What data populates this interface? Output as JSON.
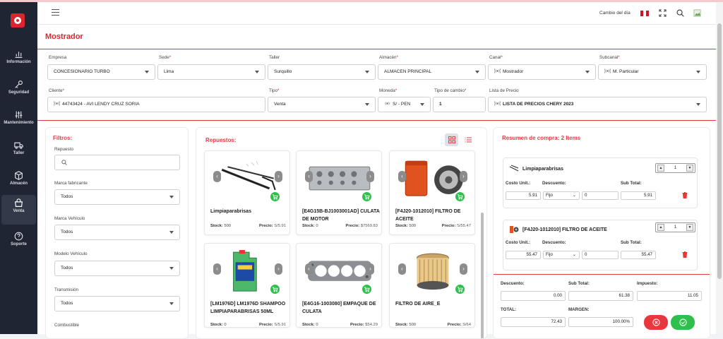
{
  "colors": {
    "accent": "#d9262e",
    "sidebar": "#1f2532",
    "green": "#2fbf4c"
  },
  "sidebar": {
    "items": [
      {
        "label": "Información",
        "icon": "bar-chart-icon"
      },
      {
        "label": "Seguridad",
        "icon": "key-icon"
      },
      {
        "label": "Mantenimiento",
        "icon": "sliders-icon"
      },
      {
        "label": "Taller",
        "icon": "truck-icon"
      },
      {
        "label": "Almacén",
        "icon": "box-icon"
      },
      {
        "label": "Venta",
        "icon": "bag-icon",
        "active": true
      },
      {
        "label": "Soporte",
        "icon": "help-icon"
      }
    ]
  },
  "header": {
    "cambio_label": "Cambio del día"
  },
  "page": {
    "title": "Mostrador"
  },
  "form": {
    "empresa": {
      "label": "Empresa",
      "value": "CONCESIONARIO TURBO"
    },
    "sede": {
      "label": "Sede",
      "value": "Lima"
    },
    "taller": {
      "label": "Taller",
      "value": "Surquillo"
    },
    "almacen": {
      "label": "Almacén",
      "value": "ALMACEN PRINCIPAL"
    },
    "canal": {
      "label": "Canal",
      "value": "Mostrador"
    },
    "subcanal": {
      "label": "Subcanal",
      "value": "M. Particular"
    },
    "cliente": {
      "label": "Cliente",
      "value": "44743424 - AVI LENDY CRUZ SORIA"
    },
    "tipo": {
      "label": "Tipo",
      "value": "Venta"
    },
    "moneda": {
      "label": "Moneda",
      "value": "S/ - PEN"
    },
    "tipo_cambio": {
      "label": "Tipo de cambio",
      "value": "1"
    },
    "lista_precio": {
      "label": "Lista de Precio",
      "value": "LISTA DE PRECIOS CHERY 2023"
    }
  },
  "filters": {
    "title": "Filtros:",
    "repuesto_label": "Repuesto",
    "marca_fabricante": {
      "label": "Marca fabricante",
      "value": "Todos"
    },
    "marca_vehiculo": {
      "label": "Marca Vehículo",
      "value": "Todos"
    },
    "modelo_vehiculo": {
      "label": "Modelo Vehículo",
      "value": "Todos"
    },
    "transmision": {
      "label": "Transmisión",
      "value": "Todos"
    },
    "combustible": {
      "label": "Combustible"
    }
  },
  "repuestos": {
    "title": "Repuestos:",
    "stock_label": "Stock:",
    "price_label": "Precio:",
    "cards": [
      {
        "name": "Limpiaparabrisas",
        "stock": "500",
        "price": "S/5.91",
        "img": "wiper"
      },
      {
        "name": "[E4G15B-BJ1003001AD] CULATA DE MOTOR",
        "stock": "0",
        "price": "$7569.83",
        "img": "head"
      },
      {
        "name": "[F4J20-1012010] FILTRO DE ACEITE",
        "stock": "500",
        "price": "S/55.47",
        "img": "oil"
      },
      {
        "name": "[LM1976D] LM1976D SHAMPOO LIMPIAPARABRISAS 50ML",
        "stock": "0",
        "price": "S/5.91",
        "img": "jug"
      },
      {
        "name": "[E4G16-1003080] EMPAQUE DE CULATA",
        "stock": "0",
        "price": "$54.29",
        "img": "gasket"
      },
      {
        "name": "FILTRO DE AIRE_E",
        "stock": "500",
        "price": "S/64",
        "img": "air"
      }
    ]
  },
  "resumen": {
    "title": "Resumen de compra: 2 Items",
    "costo_label": "Costo Unit.:",
    "descuento_label": "Descuento:",
    "subtotal_label": "Sub Total:",
    "items": [
      {
        "name": "Limpiaparabrisas",
        "qty": "1",
        "costo": "5.91",
        "tipo": "Fijo",
        "descuento": "0",
        "subtotal": "5.91"
      },
      {
        "name": "[F4J20-1012010] FILTRO DE ACEITE",
        "qty": "1",
        "costo": "55.47",
        "tipo": "Fijo",
        "descuento": "0",
        "subtotal": "55.47"
      }
    ],
    "totals": {
      "descuento_label": "Descuento:",
      "descuento": "0.00",
      "subtotal_label": "Sub Total:",
      "subtotal": "61.38",
      "impuesto_label": "Impuesto:",
      "impuesto": "11.05",
      "total_label": "TOTAL:",
      "total": "72.43",
      "margen_label": "MARGEN:",
      "margen": "100.00%"
    }
  }
}
